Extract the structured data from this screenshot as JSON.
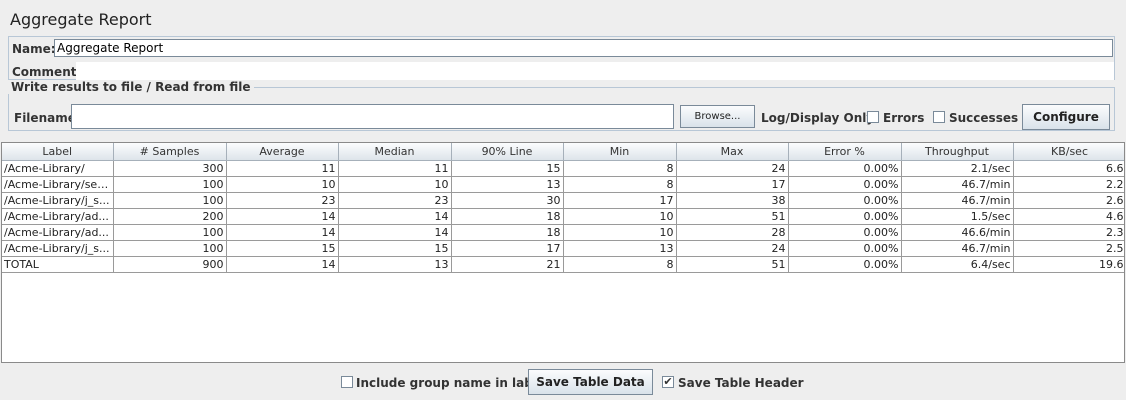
{
  "title": "Aggregate Report",
  "name_label": "Name:",
  "name_value": "Aggregate Report",
  "comments_label": "Comments:",
  "file_section": {
    "legend": "Write results to file / Read from file",
    "filename_label": "Filename",
    "filename_value": "",
    "browse_label": "Browse...",
    "log_display_label": "Log/Display Only:",
    "errors_label": "Errors",
    "errors_checked": false,
    "successes_label": "Successes",
    "successes_checked": false,
    "configure_label": "Configure"
  },
  "table": {
    "columns": [
      "Label",
      "# Samples",
      "Average",
      "Median",
      "90% Line",
      "Min",
      "Max",
      "Error %",
      "Throughput",
      "KB/sec"
    ],
    "rows": [
      [
        "/Acme-Library/",
        "300",
        "11",
        "11",
        "15",
        "8",
        "24",
        "0.00%",
        "2.1/sec",
        "6.6"
      ],
      [
        "/Acme-Library/sec...",
        "100",
        "10",
        "10",
        "13",
        "8",
        "17",
        "0.00%",
        "46.7/min",
        "2.2"
      ],
      [
        "/Acme-Library/j_s...",
        "100",
        "23",
        "23",
        "30",
        "17",
        "38",
        "0.00%",
        "46.7/min",
        "2.6"
      ],
      [
        "/Acme-Library/ad...",
        "200",
        "14",
        "14",
        "18",
        "10",
        "51",
        "0.00%",
        "1.5/sec",
        "4.6"
      ],
      [
        "/Acme-Library/ad...",
        "100",
        "14",
        "14",
        "18",
        "10",
        "28",
        "0.00%",
        "46.6/min",
        "2.3"
      ],
      [
        "/Acme-Library/j_s...",
        "100",
        "15",
        "15",
        "17",
        "13",
        "24",
        "0.00%",
        "46.7/min",
        "2.5"
      ],
      [
        "TOTAL",
        "900",
        "14",
        "13",
        "21",
        "8",
        "51",
        "0.00%",
        "6.4/sec",
        "19.6"
      ]
    ]
  },
  "bottom": {
    "include_group_label": "Include group name in label?",
    "include_group_checked": false,
    "save_table_data_label": "Save Table Data",
    "save_table_header_label": "Save Table Header",
    "save_table_header_checked": true
  }
}
